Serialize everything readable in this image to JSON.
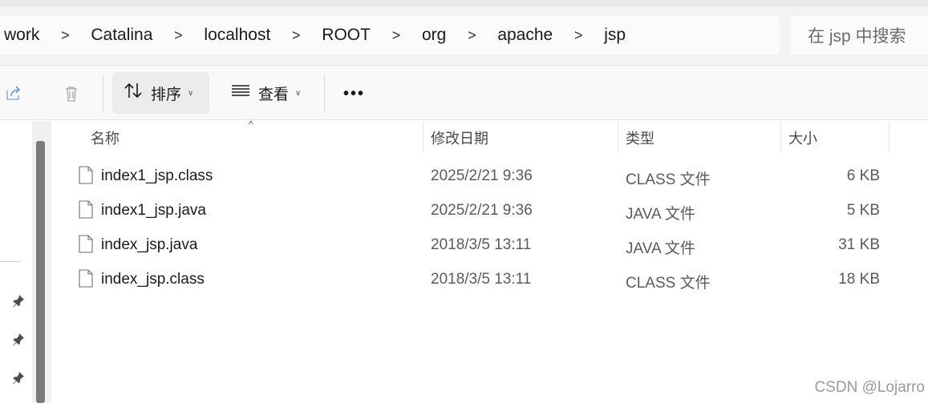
{
  "breadcrumb": [
    "work",
    "Catalina",
    "localhost",
    "ROOT",
    "org",
    "apache",
    "jsp"
  ],
  "breadcrumb_separator": ">",
  "search": {
    "placeholder": "在 jsp 中搜索"
  },
  "toolbar": {
    "sort_label": "排序",
    "view_label": "查看",
    "more_label": "•••"
  },
  "columns": {
    "name": "名称",
    "date": "修改日期",
    "type": "类型",
    "size": "大小",
    "sort_caret": "^"
  },
  "files": [
    {
      "name": "index1_jsp.class",
      "date": "2025/2/21 9:36",
      "type": "CLASS 文件",
      "size": "6 KB"
    },
    {
      "name": "index1_jsp.java",
      "date": "2025/2/21 9:36",
      "type": "JAVA 文件",
      "size": "5 KB"
    },
    {
      "name": "index_jsp.java",
      "date": "2018/3/5 13:11",
      "type": "JAVA 文件",
      "size": "31 KB"
    },
    {
      "name": "index_jsp.class",
      "date": "2018/3/5 13:11",
      "type": "CLASS 文件",
      "size": "18 KB"
    }
  ],
  "watermark": "CSDN @Lojarro",
  "icons": {
    "share": "share-icon",
    "delete": "trash-icon",
    "sort": "sort-arrows-icon",
    "view": "view-lines-icon",
    "pin": "pin-icon",
    "file": "file-icon"
  },
  "colors": {
    "accent_share": "#6a9ad6",
    "scroll_thumb": "#7a7a7a"
  }
}
